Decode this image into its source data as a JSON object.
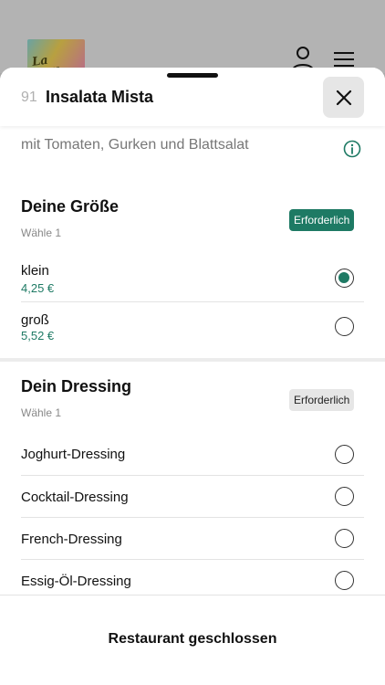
{
  "background": {
    "logo_text": "La Bella",
    "icons": [
      "user-icon",
      "hamburger-menu-icon"
    ]
  },
  "header": {
    "item_number": "91",
    "item_title": "Insalata Mista",
    "close_icon": "close-icon"
  },
  "description": "mit Tomaten, Gurken und Blattsalat",
  "info_icon": "info-icon",
  "colors": {
    "accent": "#1e7a64",
    "badge_gray": "#e6e6e6"
  },
  "size_section": {
    "title": "Deine Größe",
    "subtitle": "Wähle 1",
    "badge": "Erforderlich",
    "options": [
      {
        "label": "klein",
        "price": "4,25 €",
        "selected": true
      },
      {
        "label": "groß",
        "price": "5,52 €",
        "selected": false
      }
    ]
  },
  "dressing_section": {
    "title": "Dein Dressing",
    "subtitle": "Wähle 1",
    "badge": "Erforderlich",
    "options": [
      {
        "label": "Joghurt-Dressing",
        "selected": false
      },
      {
        "label": "Cocktail-Dressing",
        "selected": false
      },
      {
        "label": "French-Dressing",
        "selected": false
      },
      {
        "label": "Essig-Öl-Dressing",
        "selected": false
      }
    ]
  },
  "footer": {
    "status": "Restaurant geschlossen"
  }
}
